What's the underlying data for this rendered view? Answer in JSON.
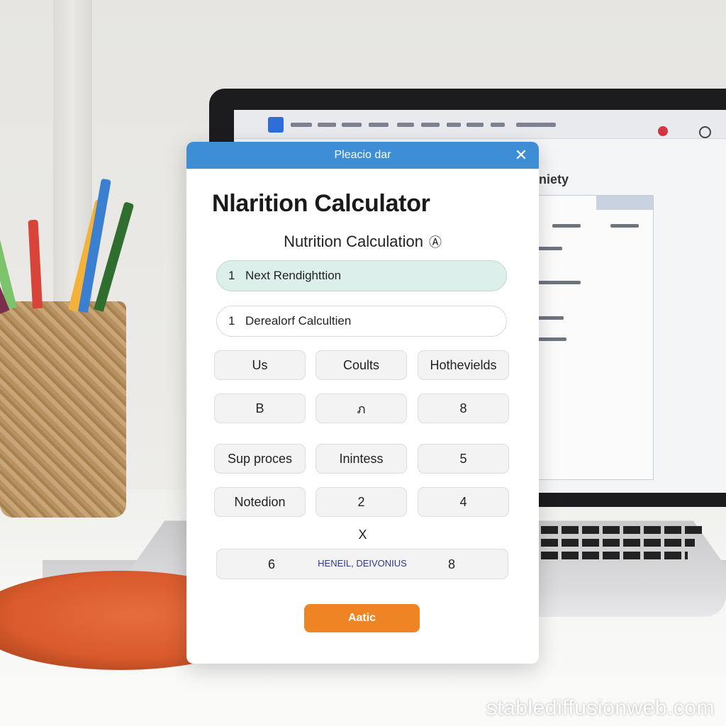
{
  "dialog": {
    "header_title": "Pleacio dar",
    "close_icon": "✕",
    "main_title": "Nlarition Calculator",
    "subtitle": "Nutrition Calculation",
    "subtitle_icon": "Ⓐ",
    "fields": [
      {
        "number": "1",
        "label": "Next Rendighttion"
      },
      {
        "number": "1",
        "label": "Derealorf Calcultien"
      }
    ],
    "buttons": [
      {
        "label": "Us"
      },
      {
        "label": "Coults"
      },
      {
        "label": "Hothevields"
      },
      {
        "label": "B"
      },
      {
        "label": "ภ"
      },
      {
        "label": "8"
      },
      {
        "label": "Sup proces"
      },
      {
        "label": "Inintess"
      },
      {
        "label": "5"
      },
      {
        "label": "Notedion"
      },
      {
        "label": "2"
      },
      {
        "label": "4"
      }
    ],
    "x_mark": "X",
    "result": {
      "left": "6",
      "middle": "HENEIL, DEIVONIUS",
      "right": "8"
    },
    "action_button": "Aatic"
  },
  "laptop_screen": {
    "heading": "niety"
  },
  "watermark": "stablediffusionweb.com",
  "colors": {
    "header_blue": "#3e8ed6",
    "action_orange": "#ef8424",
    "active_field": "#dcefea"
  }
}
